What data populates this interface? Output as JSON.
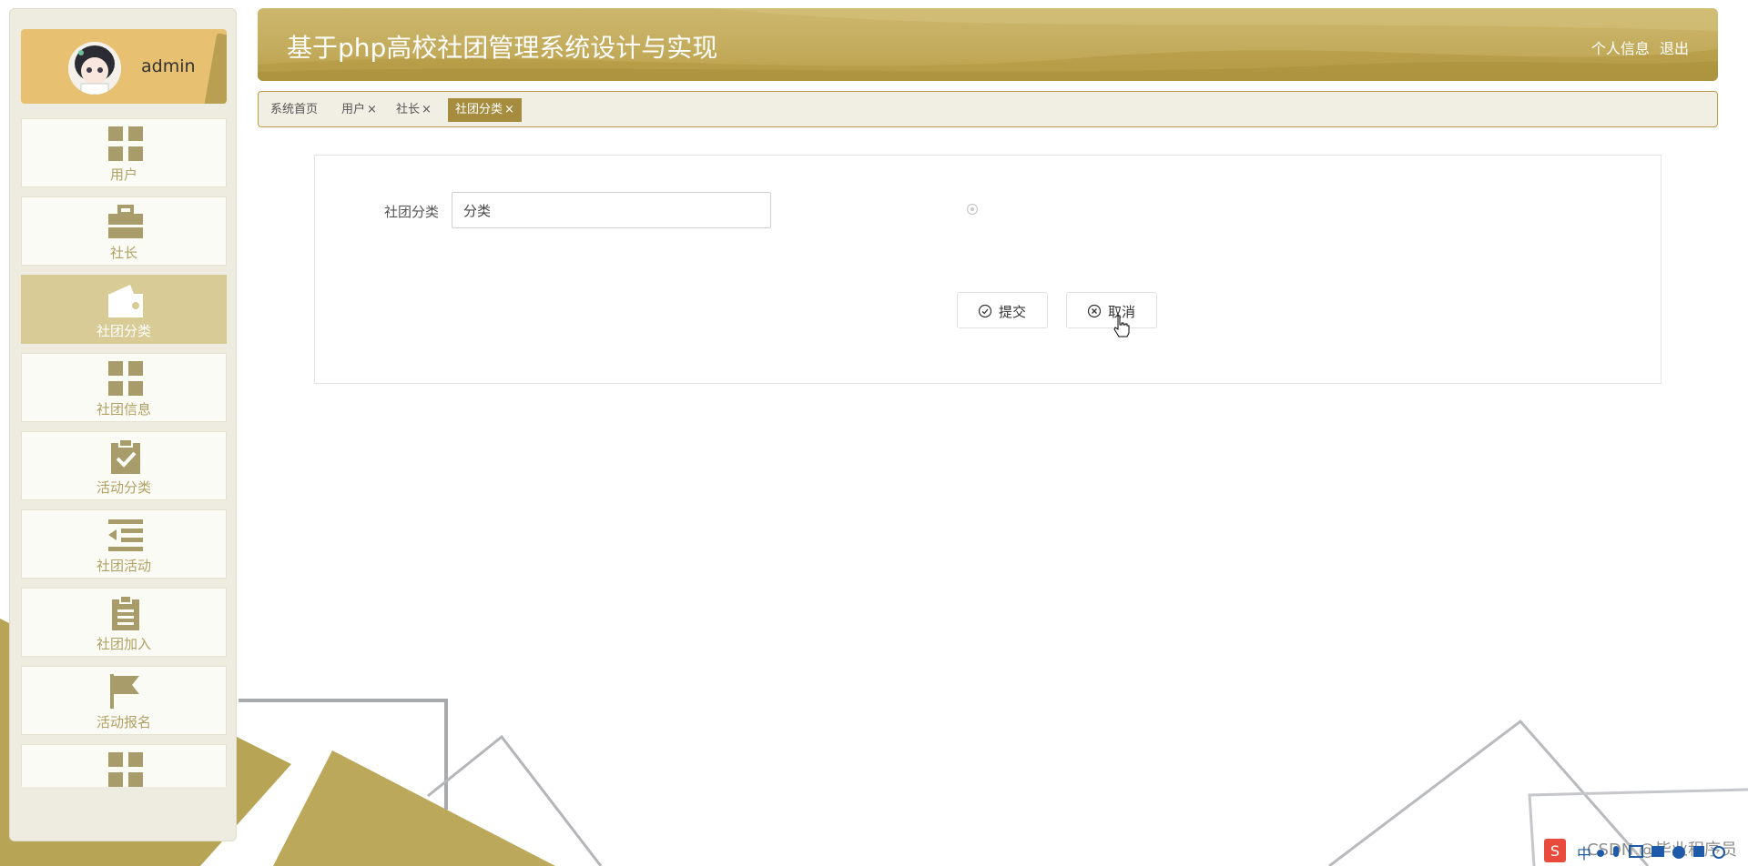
{
  "header": {
    "title": "基于php高校社团管理系统设计与实现",
    "profile_link": "个人信息",
    "logout_link": "退出"
  },
  "sidebar": {
    "username": "admin",
    "items": [
      {
        "label": "用户",
        "icon": "grid-icon"
      },
      {
        "label": "社长",
        "icon": "briefcase-icon"
      },
      {
        "label": "社团分类",
        "icon": "wallet-icon",
        "active": true
      },
      {
        "label": "社团信息",
        "icon": "grid-icon"
      },
      {
        "label": "活动分类",
        "icon": "clipboard-check-icon"
      },
      {
        "label": "社团活动",
        "icon": "indent-list-icon"
      },
      {
        "label": "社团加入",
        "icon": "clipboard-list-icon"
      },
      {
        "label": "活动报名",
        "icon": "flag-icon"
      },
      {
        "label": "",
        "icon": "grid-icon"
      }
    ]
  },
  "tabs": [
    {
      "label": "系统首页"
    },
    {
      "label": "用户",
      "close": "×"
    },
    {
      "label": "社长",
      "close": "×"
    },
    {
      "label": "社团分类",
      "close": "×",
      "active": true
    }
  ],
  "form": {
    "field_label": "社团分类",
    "field_value": "分类",
    "submit_label": "提交",
    "cancel_label": "取消"
  },
  "watermark": "CSDN @毕业程序员",
  "tray": {
    "ime_label": "中"
  },
  "colors": {
    "accent": "#b89f48",
    "active_tab": "#a58c3e",
    "menu_text": "#b1a063"
  }
}
